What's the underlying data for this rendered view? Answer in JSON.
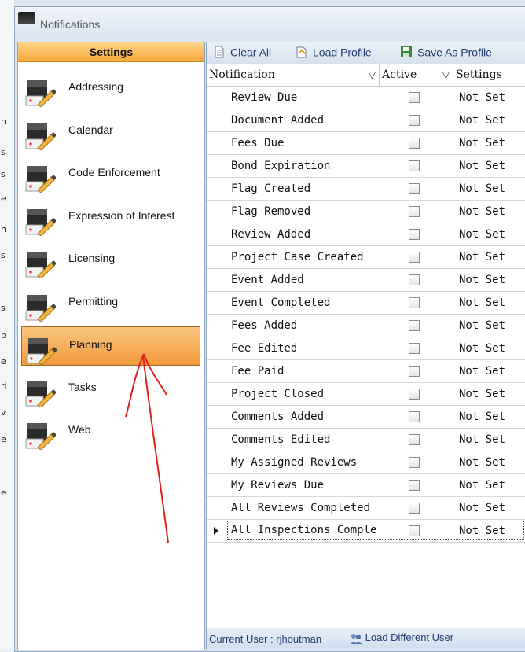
{
  "window": {
    "title": "Notifications"
  },
  "background": {
    "letters": [
      "n",
      "s",
      "s",
      "e",
      "n",
      "s",
      "s",
      "p",
      "e",
      "ri",
      "v",
      "e",
      "e"
    ]
  },
  "sidebar": {
    "header": "Settings",
    "items": [
      {
        "label": "Addressing",
        "selected": false
      },
      {
        "label": "Calendar",
        "selected": false
      },
      {
        "label": "Code Enforcement",
        "selected": false
      },
      {
        "label": "Expression of Interest",
        "selected": false
      },
      {
        "label": "Licensing",
        "selected": false
      },
      {
        "label": "Permitting",
        "selected": false
      },
      {
        "label": "Planning",
        "selected": true
      },
      {
        "label": "Tasks",
        "selected": false
      },
      {
        "label": "Web",
        "selected": false
      }
    ]
  },
  "toolbar": {
    "clear_all": "Clear All",
    "load_profile": "Load Profile",
    "save_as_profile": "Save As Profile"
  },
  "grid": {
    "columns": {
      "notification": "Notification",
      "active": "Active",
      "settings": "Settings"
    },
    "rows": [
      {
        "name": "Review Due",
        "active": false,
        "settings": "Not Set"
      },
      {
        "name": "Document Added",
        "active": false,
        "settings": "Not Set"
      },
      {
        "name": "Fees Due",
        "active": false,
        "settings": "Not Set"
      },
      {
        "name": "Bond Expiration",
        "active": false,
        "settings": "Not Set"
      },
      {
        "name": "Flag Created",
        "active": false,
        "settings": "Not Set"
      },
      {
        "name": "Flag Removed",
        "active": false,
        "settings": "Not Set"
      },
      {
        "name": "Review Added",
        "active": false,
        "settings": "Not Set"
      },
      {
        "name": "Project Case Created",
        "active": false,
        "settings": "Not Set"
      },
      {
        "name": "Event Added",
        "active": false,
        "settings": "Not Set"
      },
      {
        "name": "Event Completed",
        "active": false,
        "settings": "Not Set"
      },
      {
        "name": "Fees Added",
        "active": false,
        "settings": "Not Set"
      },
      {
        "name": "Fee Edited",
        "active": false,
        "settings": "Not Set"
      },
      {
        "name": "Fee Paid",
        "active": false,
        "settings": "Not Set"
      },
      {
        "name": "Project Closed",
        "active": false,
        "settings": "Not Set"
      },
      {
        "name": "Comments Added",
        "active": false,
        "settings": "Not Set"
      },
      {
        "name": "Comments Edited",
        "active": false,
        "settings": "Not Set"
      },
      {
        "name": "My Assigned Reviews",
        "active": false,
        "settings": "Not Set"
      },
      {
        "name": "My Reviews Due",
        "active": false,
        "settings": "Not Set"
      },
      {
        "name": "All Reviews Completed",
        "active": false,
        "settings": "Not Set"
      },
      {
        "name": "All Inspections Comple",
        "active": false,
        "settings": "Not Set",
        "current": true
      }
    ]
  },
  "status": {
    "current_user": "Current User : rjhoutman",
    "load_different_user": "Load Different User"
  },
  "colors": {
    "accent": "#f39a3c",
    "annotation": "#e0201b",
    "link": "#1e3d6e"
  }
}
